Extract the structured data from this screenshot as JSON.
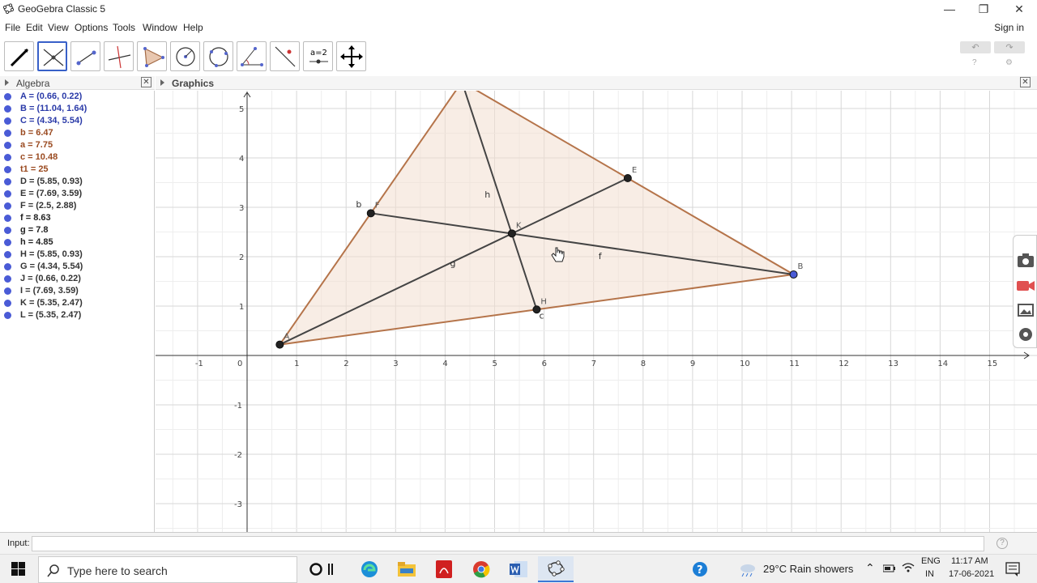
{
  "window": {
    "title": "GeoGebra Classic 5",
    "minimize": "—",
    "restore": "❐",
    "close": "✕"
  },
  "menu": {
    "items": [
      "File",
      "Edit",
      "View",
      "Options",
      "Tools",
      "Window",
      "Help"
    ],
    "sign_in": "Sign in"
  },
  "toolbar": {
    "tools": [
      "move-tool",
      "point-tool",
      "line-tool",
      "perpendicular-line-tool",
      "polygon-tool",
      "circle-tool",
      "conic-tool",
      "angle-tool",
      "reflect-tool",
      "slider-tool",
      "move-graphics-tool"
    ],
    "selected_index": 1,
    "slider_label": "a=2",
    "undo": "↶",
    "redo": "↷"
  },
  "algebra": {
    "title": "Algebra",
    "rows": [
      {
        "text": "A = (0.66, 0.22)",
        "color": "#2a3aa8"
      },
      {
        "text": "B = (11.04, 1.64)",
        "color": "#2a3aa8"
      },
      {
        "text": "C = (4.34, 5.54)",
        "color": "#2a3aa8"
      },
      {
        "text": "b = 6.47",
        "color": "#9a4a20"
      },
      {
        "text": "a = 7.75",
        "color": "#9a4a20"
      },
      {
        "text": "c = 10.48",
        "color": "#9a4a20"
      },
      {
        "text": "t1 = 25",
        "color": "#9a4a20"
      },
      {
        "text": "D = (5.85, 0.93)",
        "color": "#333333"
      },
      {
        "text": "E = (7.69, 3.59)",
        "color": "#333333"
      },
      {
        "text": "F = (2.5, 2.88)",
        "color": "#333333"
      },
      {
        "text": "f = 8.63",
        "color": "#222222"
      },
      {
        "text": "g = 7.8",
        "color": "#222222"
      },
      {
        "text": "h = 4.85",
        "color": "#222222"
      },
      {
        "text": "H = (5.85, 0.93)",
        "color": "#333333"
      },
      {
        "text": "G = (4.34, 5.54)",
        "color": "#333333"
      },
      {
        "text": "J = (0.66, 0.22)",
        "color": "#333333"
      },
      {
        "text": "I = (7.69, 3.59)",
        "color": "#333333"
      },
      {
        "text": "K = (5.35, 2.47)",
        "color": "#333333"
      },
      {
        "text": "L = (5.35, 2.47)",
        "color": "#333333"
      }
    ]
  },
  "graphics": {
    "title": "Graphics",
    "x_range": [
      -1.8,
      15.8
    ],
    "y_range": [
      -3.5,
      5.4
    ],
    "x_ticks": [
      -1,
      0,
      1,
      2,
      3,
      4,
      5,
      6,
      7,
      8,
      9,
      10,
      11,
      12,
      13,
      14,
      15
    ],
    "y_ticks": [
      -3,
      -2,
      -1,
      1,
      2,
      3,
      4,
      5
    ],
    "triangle": {
      "A": [
        0.66,
        0.22
      ],
      "B": [
        11.04,
        1.64
      ],
      "C": [
        4.34,
        5.54
      ],
      "fill": "#f3dfd0",
      "edge": "#b5744a"
    },
    "segments": [
      {
        "from": [
          0.66,
          0.22
        ],
        "to": [
          7.69,
          3.59
        ],
        "label": "g",
        "label_at": [
          4.1,
          1.8
        ]
      },
      {
        "from": [
          11.04,
          1.64
        ],
        "to": [
          2.5,
          2.88
        ],
        "label": "f",
        "label_at": [
          7.1,
          1.95
        ]
      },
      {
        "from": [
          4.34,
          5.54
        ],
        "to": [
          5.85,
          0.93
        ],
        "label": "h",
        "label_at": [
          4.8,
          3.2
        ]
      }
    ],
    "points": [
      {
        "name": "A",
        "at": [
          0.66,
          0.22
        ],
        "label": "A",
        "color": "#222"
      },
      {
        "name": "B",
        "at": [
          11.04,
          1.64
        ],
        "label": "B",
        "color": "#4a5bd6"
      },
      {
        "name": "D",
        "at": [
          5.85,
          0.93
        ],
        "label": "H",
        "color": "#222"
      },
      {
        "name": "E",
        "at": [
          7.69,
          3.59
        ],
        "label": "E",
        "color": "#222"
      },
      {
        "name": "F",
        "at": [
          2.5,
          2.88
        ],
        "label": "F",
        "color": "#222"
      },
      {
        "name": "K",
        "at": [
          5.35,
          2.47
        ],
        "label": "K",
        "color": "#222"
      }
    ],
    "side_labels": [
      {
        "text": "b",
        "at": [
          2.2,
          3.0
        ]
      },
      {
        "text": "c",
        "at": [
          5.9,
          0.75
        ]
      }
    ]
  },
  "input": {
    "label": "Input:",
    "value": "",
    "help": "?"
  },
  "taskbar": {
    "search_placeholder": "Type here to search",
    "weather": "29°C  Rain showers",
    "language": "ENG",
    "region": "IN",
    "time": "11:17 AM",
    "date": "17-06-2021"
  }
}
